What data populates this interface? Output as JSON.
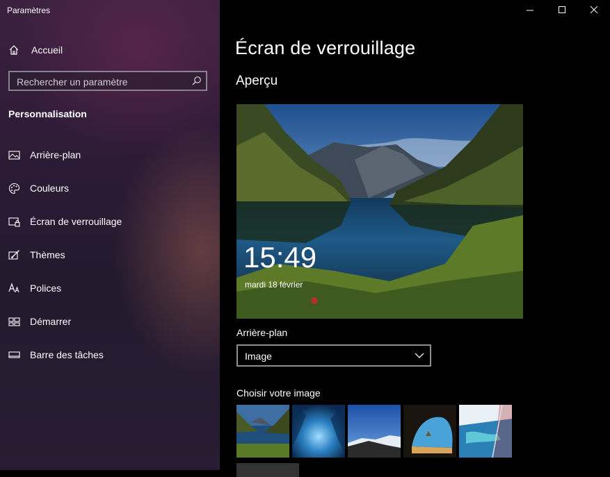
{
  "window": {
    "title": "Paramètres"
  },
  "sidebar": {
    "home_label": "Accueil",
    "search_placeholder": "Rechercher un paramètre",
    "section_title": "Personnalisation",
    "items": [
      {
        "label": "Arrière-plan",
        "icon": "picture-icon"
      },
      {
        "label": "Couleurs",
        "icon": "palette-icon"
      },
      {
        "label": "Écran de verrouillage",
        "icon": "lock-screen-icon"
      },
      {
        "label": "Thèmes",
        "icon": "theme-brush-icon"
      },
      {
        "label": "Polices",
        "icon": "font-icon"
      },
      {
        "label": "Démarrer",
        "icon": "start-grid-icon"
      },
      {
        "label": "Barre des tâches",
        "icon": "taskbar-icon"
      }
    ]
  },
  "main": {
    "page_title": "Écran de verrouillage",
    "preview_heading": "Aperçu",
    "preview_time": "15:49",
    "preview_date": "mardi 18 février",
    "background_label": "Arrière-plan",
    "background_value": "Image",
    "choose_label": "Choisir votre image",
    "thumbnails": [
      {
        "icon": "lake-mountains-thumbnail"
      },
      {
        "icon": "ice-cave-thumbnail"
      },
      {
        "icon": "mountain-summit-clouds-thumbnail"
      },
      {
        "icon": "sea-cave-beach-thumbnail"
      },
      {
        "icon": "aerial-coast-thumbnail"
      }
    ]
  },
  "colors": {
    "sidebar_bg": "#2c1b35",
    "main_bg": "#000000",
    "input_border": "#8f8f8f"
  }
}
